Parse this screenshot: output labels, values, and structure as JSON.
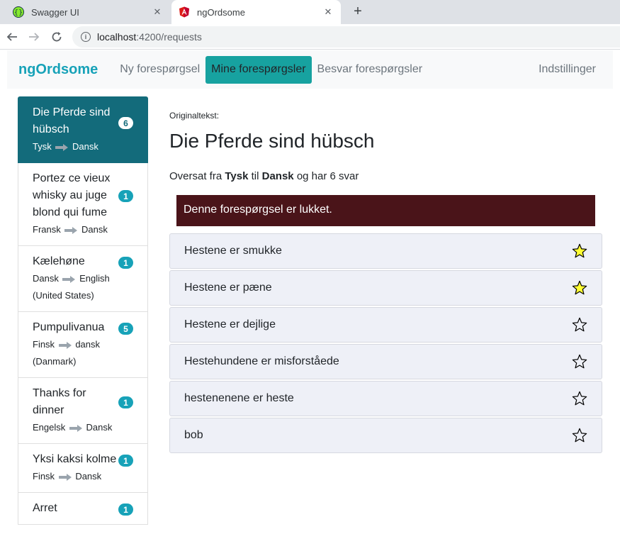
{
  "browser": {
    "tabs": [
      {
        "title": "Swagger UI",
        "active": false
      },
      {
        "title": "ngOrdsome",
        "active": true
      }
    ],
    "address": {
      "host": "localhost",
      "rest": ":4200/requests"
    }
  },
  "navbar": {
    "brand": "ngOrdsome",
    "links": [
      "Ny forespørgsel",
      "Mine forespørgsler",
      "Besvar forespørgsler"
    ],
    "active_link": "Mine forespørgsler",
    "settings": "Indstillinger"
  },
  "requests": [
    {
      "text": "Die Pferde sind hübsch",
      "from": "Tysk",
      "to": "Dansk",
      "count": "6",
      "active": true
    },
    {
      "text": "Portez ce vieux whisky au juge blond qui fume",
      "from": "Fransk",
      "to": "Dansk",
      "count": "1"
    },
    {
      "text": "Kælehøne",
      "from": "Dansk",
      "to": "English (United States)",
      "count": "1"
    },
    {
      "text": "Pumpulivanua",
      "from": "Finsk",
      "to": "dansk (Danmark)",
      "count": "5"
    },
    {
      "text": "Thanks for dinner",
      "from": "Engelsk",
      "to": "Dansk",
      "count": "1"
    },
    {
      "text": "Yksi kaksi kolme",
      "from": "Finsk",
      "to": "Dansk",
      "count": "1"
    },
    {
      "text": "Arret",
      "from": "",
      "to": "",
      "count": "1"
    }
  ],
  "detail": {
    "label": "Originaltekst:",
    "title": "Die Pferde sind hübsch",
    "summary": {
      "prefix": "Oversat fra",
      "from": "Tysk",
      "mid": "til",
      "to": "Dansk",
      "suffix": "og har 6 svar"
    },
    "closed_message": "Denne forespørgsel er lukket.",
    "answers": [
      {
        "text": "Hestene er smukke",
        "starred": true
      },
      {
        "text": "Hestene er pæne",
        "starred": true
      },
      {
        "text": "Hestene er dejlige",
        "starred": false
      },
      {
        "text": "Hestehundene er misforståede",
        "starred": false
      },
      {
        "text": "hestenenene er heste",
        "starred": false
      },
      {
        "text": "bob",
        "starred": false
      }
    ]
  },
  "colors": {
    "brand": "#17a2b8",
    "active_nav": "#17a2a0",
    "active_item": "#136b7b",
    "alert_bg": "#4a1419",
    "star_fill": "#ffff33"
  }
}
